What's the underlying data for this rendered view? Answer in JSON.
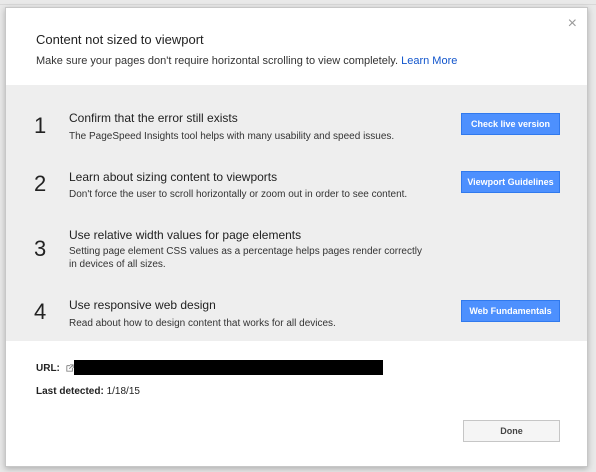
{
  "dialog": {
    "title": "Content not sized to viewport",
    "subtitle": "Make sure your pages don't require horizontal scrolling to view completely.",
    "learn_more": "Learn More",
    "close_glyph": "×"
  },
  "steps": [
    {
      "num": "1",
      "title": "Confirm that the error still exists",
      "desc": "The PageSpeed Insights tool helps with many usability and speed issues.",
      "button": "Check live version"
    },
    {
      "num": "2",
      "title": "Learn about sizing content to viewports",
      "desc": "Don't force the user to scroll horizontally or zoom out in order to see content.",
      "button": "Viewport Guidelines"
    },
    {
      "num": "3",
      "title": "Use relative width values for page elements",
      "desc": "Setting page element CSS values as a percentage helps pages render correctly in devices of all sizes.",
      "button": ""
    },
    {
      "num": "4",
      "title": "Use responsive web design",
      "desc": "Read about how to design content that works for all devices.",
      "button": "Web Fundamentals"
    }
  ],
  "details": {
    "url_label": "URL:",
    "last_detected_label": "Last detected:",
    "last_detected_value": "1/18/15"
  },
  "footer": {
    "done": "Done"
  },
  "colors": {
    "primary": "#4d90fe",
    "link": "#1155cc",
    "panel": "#eeeeee"
  }
}
